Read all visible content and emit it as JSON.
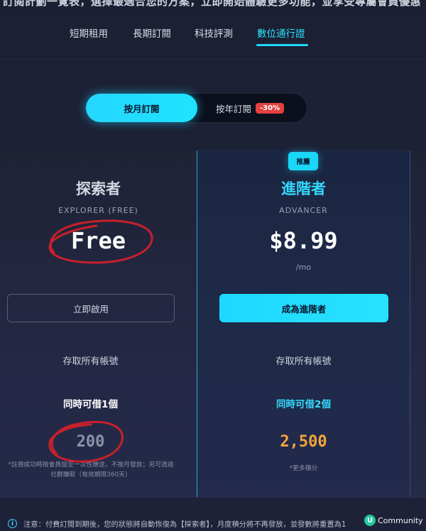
{
  "top_strip": {
    "text": "訂閱計劃一覽表，選擇最適合您的方案，立即開始體驗更多功能，並享受專屬會員優惠"
  },
  "nav": {
    "tabs": [
      "短期租用",
      "長期訂閱",
      "科技評測",
      "數位通行證"
    ],
    "active": "數位通行證"
  },
  "billing_toggle": {
    "monthly": "按月訂閱",
    "yearly": "按年訂閱",
    "discount": "-30%"
  },
  "plans": {
    "free": {
      "name": "探索者",
      "subtitle": "EXPLORER (FREE)",
      "price": "Free",
      "cta": "立即啟用",
      "feature": "存取所有帳號",
      "borrow": "同時可借1個",
      "points": "200",
      "note": "*註冊成功時按會員設定一次性贈送，不按月發放；另可透過社群賺取（有效期限360天）"
    },
    "advancer": {
      "badge": "推薦",
      "name": "進階者",
      "subtitle": "ADVANCER",
      "price": "$8.99",
      "period": "/mo",
      "cta": "成為進階者",
      "feature": "存取所有帳號",
      "borrow": "同時可借2個",
      "points": "2,500",
      "note": "*更多積分"
    }
  },
  "footer": {
    "info_icon": "i",
    "text": "注意：付費訂閱到期後，您的狀態將自動恢復為【探索者】，月度積分將不再發放，並發數將重置為1"
  },
  "watermark": {
    "logo": "U",
    "text": "Community"
  },
  "colors": {
    "accent": "#20d7f7",
    "discount": "#e4413f",
    "points_gold": "#f5a53a",
    "annotation_red": "#c8202a"
  }
}
